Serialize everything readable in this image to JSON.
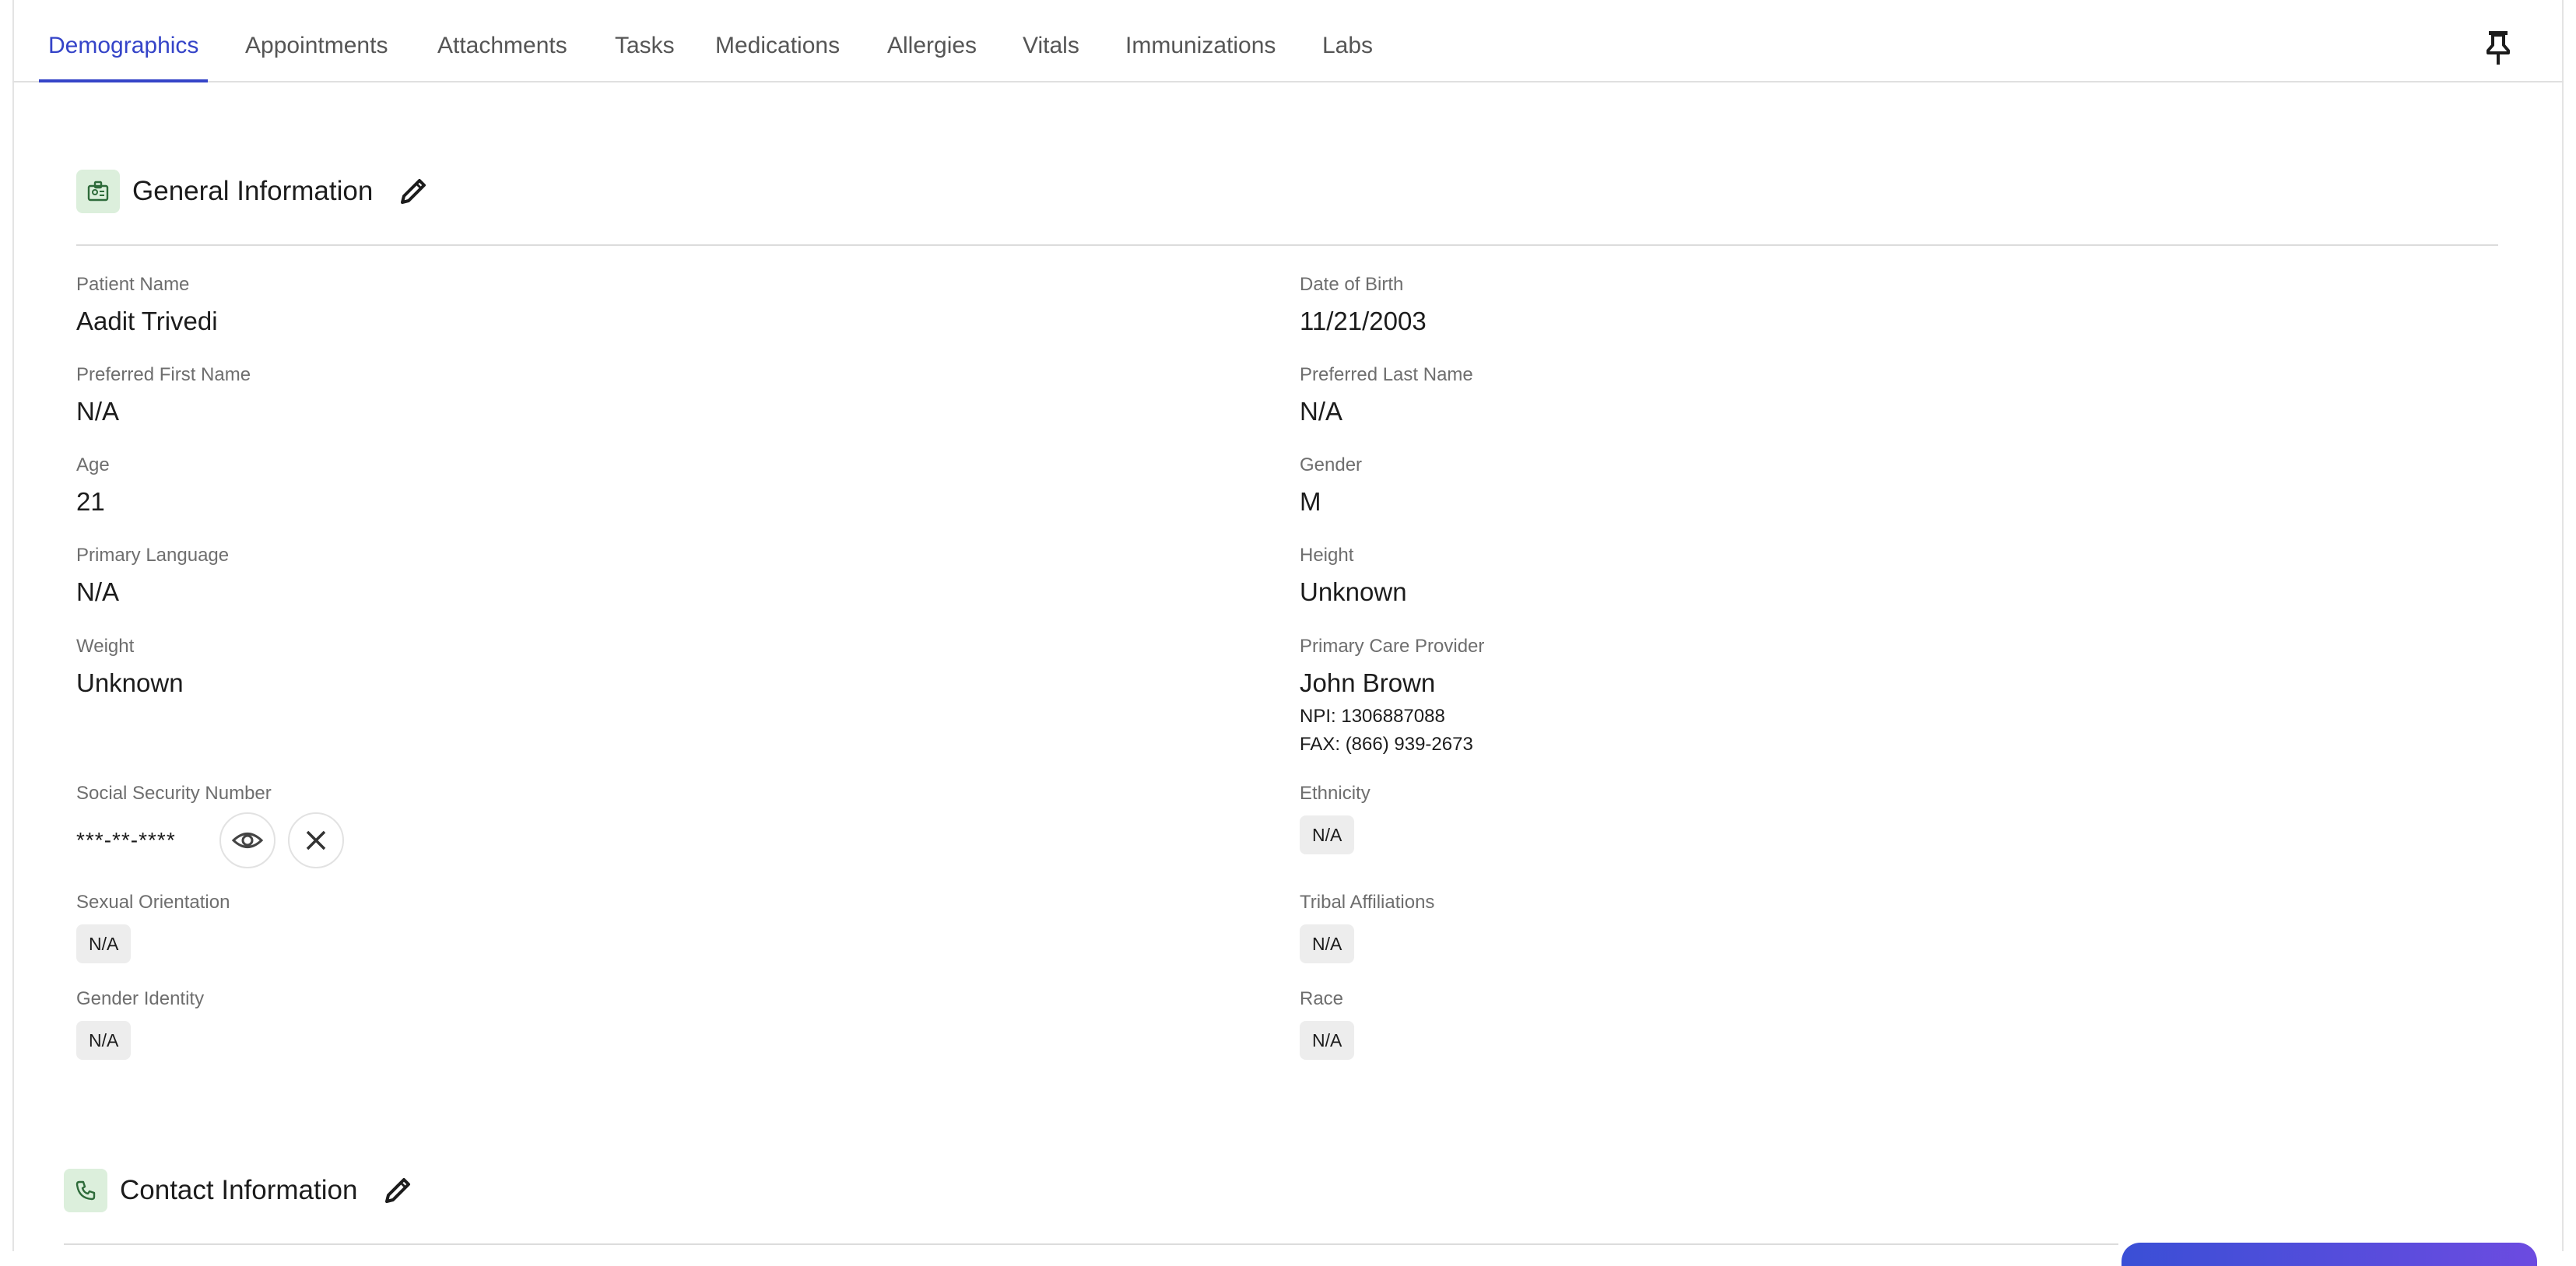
{
  "tabs": [
    {
      "label": "Demographics",
      "active": true
    },
    {
      "label": "Appointments",
      "active": false
    },
    {
      "label": "Attachments",
      "active": false
    },
    {
      "label": "Tasks",
      "active": false
    },
    {
      "label": "Medications",
      "active": false
    },
    {
      "label": "Allergies",
      "active": false
    },
    {
      "label": "Vitals",
      "active": false
    },
    {
      "label": "Immunizations",
      "active": false
    },
    {
      "label": "Labs",
      "active": false
    }
  ],
  "icons": {
    "pin": "pin-icon",
    "general": "id-badge-icon",
    "contact": "phone-icon",
    "edit": "pencil-icon",
    "show": "eye-icon",
    "close": "close-icon"
  },
  "colors": {
    "accent": "#3544c8",
    "icon_bg": "#dcefdc",
    "chip_bg": "#ededed"
  },
  "general": {
    "title": "General Information",
    "left": [
      {
        "label": "Patient Name",
        "value": "Aadit Trivedi"
      },
      {
        "label": "Preferred First Name",
        "value": "N/A"
      },
      {
        "label": "Age",
        "value": "21"
      },
      {
        "label": "Primary Language",
        "value": "N/A"
      },
      {
        "label": "Weight",
        "value": "Unknown"
      }
    ],
    "right": [
      {
        "label": "Date of Birth",
        "value": "11/21/2003"
      },
      {
        "label": "Preferred Last Name",
        "value": "N/A"
      },
      {
        "label": "Gender",
        "value": "M"
      },
      {
        "label": "Height",
        "value": "Unknown"
      }
    ],
    "pcp": {
      "label": "Primary Care Provider",
      "name": "John Brown",
      "npi": "NPI: 1306887088",
      "fax": "FAX: (866) 939-2673"
    },
    "ssn": {
      "label": "Social Security Number",
      "value": "***-**-****"
    },
    "chips": {
      "ethnicity": {
        "label": "Ethnicity",
        "value": "N/A"
      },
      "sexual_orientation": {
        "label": "Sexual Orientation",
        "value": "N/A"
      },
      "tribal": {
        "label": "Tribal Affiliations",
        "value": "N/A"
      },
      "gender_identity": {
        "label": "Gender Identity",
        "value": "N/A"
      },
      "race": {
        "label": "Race",
        "value": "N/A"
      }
    }
  },
  "contact": {
    "title": "Contact Information"
  }
}
